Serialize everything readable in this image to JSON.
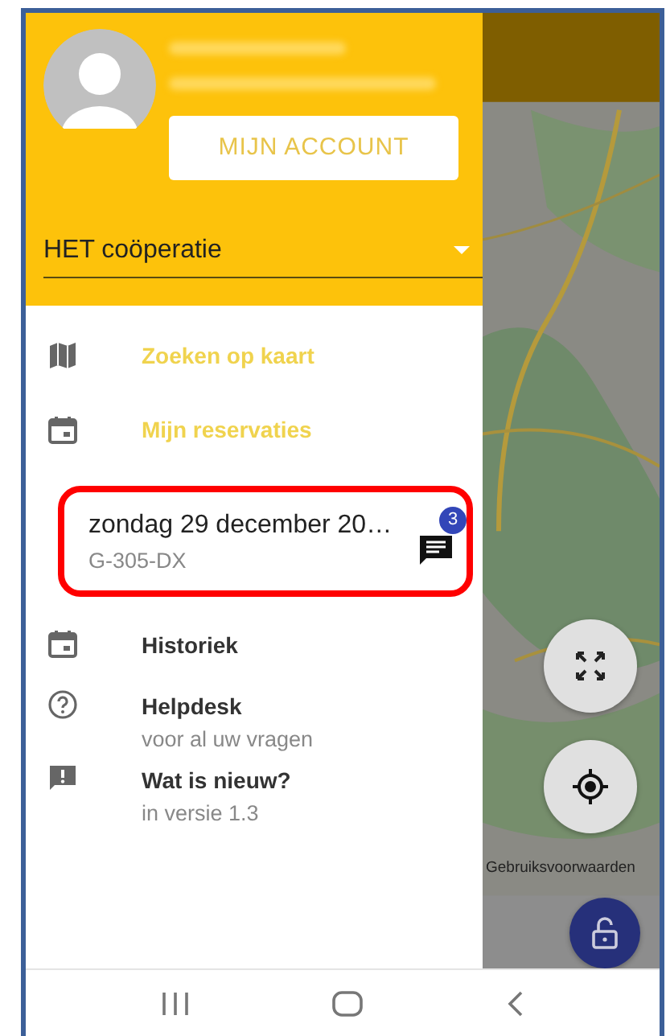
{
  "header": {
    "account_button": "MIJN ACCOUNT",
    "organization": "HET coöperatie"
  },
  "menu": [
    {
      "kind": "link",
      "label": "Zoeken op kaart"
    },
    {
      "kind": "link",
      "label": "Mijn reservaties"
    },
    {
      "kind": "reservation",
      "label": "zondag 29 december 20…",
      "subtitle": "G-305-DX",
      "badge": "3",
      "highlighted": true
    },
    {
      "kind": "item",
      "label": "Historiek"
    },
    {
      "kind": "item",
      "label": "Helpdesk",
      "subtitle": "voor al uw vragen"
    },
    {
      "kind": "item",
      "label": "Wat is nieuw?",
      "subtitle": "in versie 1.3"
    }
  ],
  "map": {
    "terms_link": "Gebruiksvoorwaarden"
  }
}
